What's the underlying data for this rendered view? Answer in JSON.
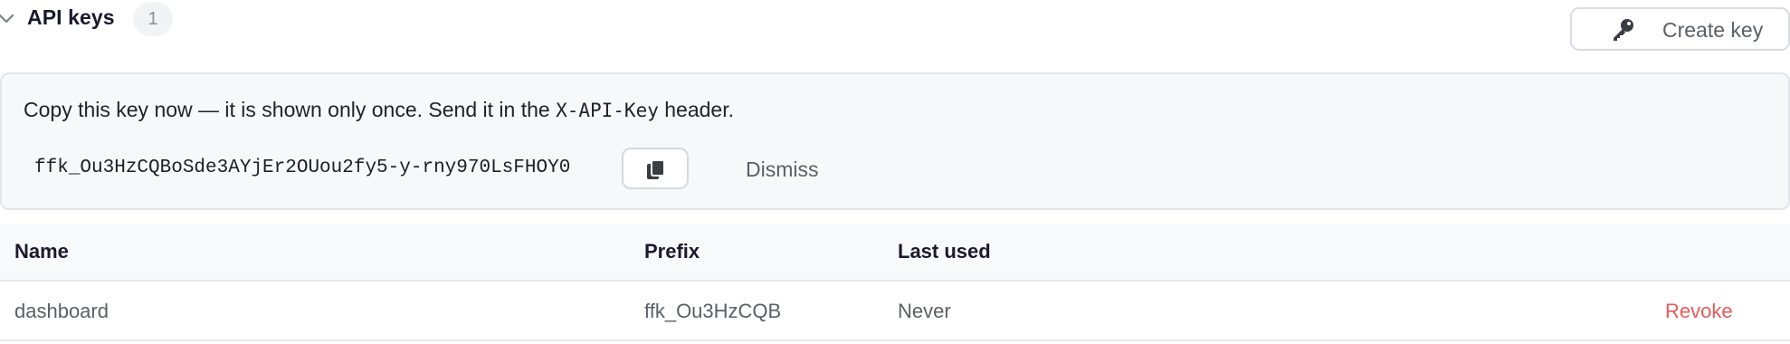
{
  "section": {
    "title": "API keys",
    "count": "1",
    "create_button_label": "Create key"
  },
  "notice": {
    "message_before": "Copy this key now — it is shown only once. Send it in the ",
    "header_name": "X-API-Key",
    "message_after": " header.",
    "key_value": "ffk_Ou3HzCQBoSde3AYjEr2OUou2fy5-y-rny970LsFHOY0",
    "dismiss_label": "Dismiss"
  },
  "table": {
    "columns": [
      "Name",
      "Prefix",
      "Last used"
    ],
    "rows": [
      {
        "name": "dashboard",
        "prefix": "ffk_Ou3HzCQB",
        "last_used": "Never",
        "action": "Revoke"
      }
    ]
  },
  "colors": {
    "danger": "#e85a5a",
    "border": "#d9dce1",
    "notice_bg": "#f7f8f9"
  },
  "icons": {
    "collapse": "chevron-down-icon",
    "create": "key-icon",
    "copy": "copy-icon"
  }
}
